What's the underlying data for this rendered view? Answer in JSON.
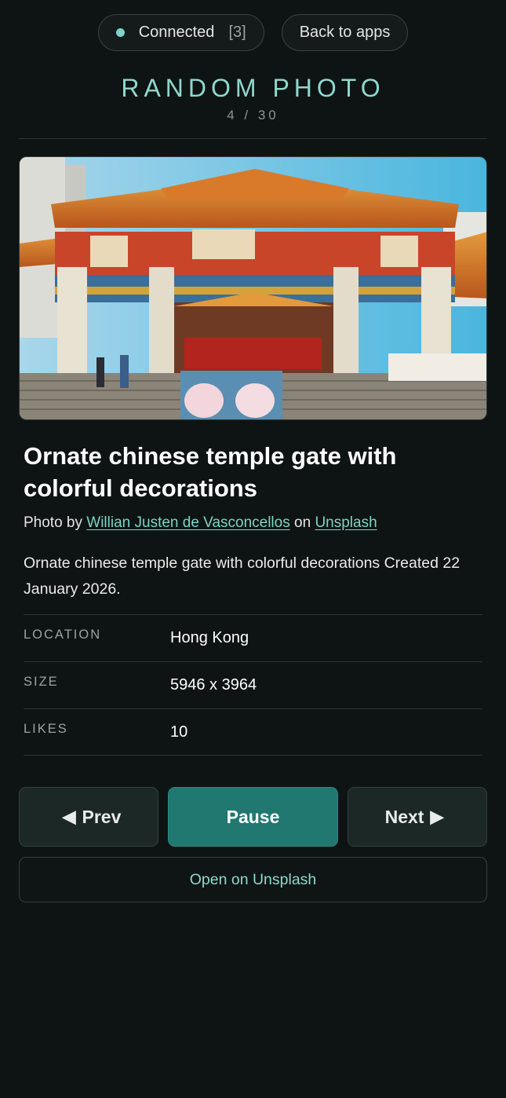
{
  "header": {
    "status_label": "Connected",
    "status_count": "[3]",
    "back_label": "Back to apps",
    "title": "RANDOM PHOTO",
    "counter": "4 / 30"
  },
  "photo": {
    "title": "Ornate chinese temple gate with colorful decorations",
    "credit_prefix": "Photo by",
    "author": "Willian Justen de Vasconcellos",
    "credit_middle": "on",
    "source": "Unsplash",
    "description": "Ornate chinese temple gate with colorful decorations Created 22 January 2026."
  },
  "meta": [
    {
      "key": "LOCATION",
      "value": "Hong Kong"
    },
    {
      "key": "SIZE",
      "value": "5946 x 3964"
    },
    {
      "key": "LIKES",
      "value": "10"
    }
  ],
  "controls": {
    "prev_label": "Prev",
    "pause_label": "Pause",
    "next_label": "Next",
    "open_label": "Open on Unsplash"
  },
  "colors": {
    "accent": "#7dd3c8",
    "primary_button": "#207870",
    "background": "#0e1413"
  }
}
